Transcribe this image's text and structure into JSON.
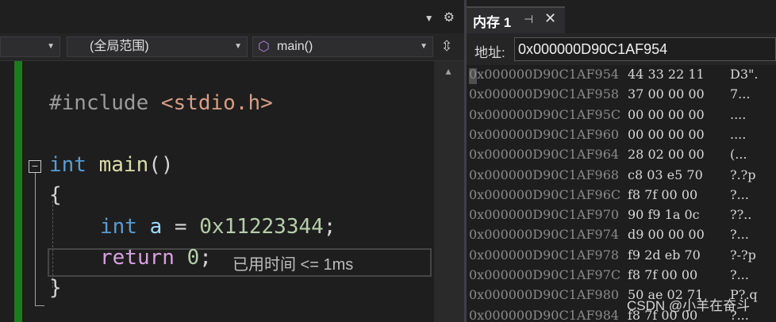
{
  "editor": {
    "navbar": {
      "project_dropdown": "",
      "scope_dropdown": "(全局范围)",
      "function_dropdown": "main()"
    },
    "code_lines": {
      "line1": {
        "text": "#include <stdio.h>",
        "directive": "#include",
        "header": "<stdio.h>"
      },
      "line2": {
        "kw": "int",
        "fn": "main",
        "rest": "()"
      },
      "line3": "{",
      "line4": {
        "kw": "int",
        "var": "a",
        "op": " = ",
        "num": "0x11223344",
        "end": ";"
      },
      "line5": {
        "kw": "return",
        "num": "0",
        "end": ";"
      },
      "line6": "}"
    },
    "perf_tip": "已用时间 <= 1ms",
    "fold_glyph": "⊟"
  },
  "memory": {
    "tab_title": "内存 1",
    "address_label": "地址:",
    "address_value": "0x000000D90C1AF954",
    "rows": [
      {
        "addr": "0x000000D90C1AF954",
        "bytes": "44 33 22 11",
        "ascii": "D3\"."
      },
      {
        "addr": "0x000000D90C1AF958",
        "bytes": "37 00 00 00",
        "ascii": "7..."
      },
      {
        "addr": "0x000000D90C1AF95C",
        "bytes": "00 00 00 00",
        "ascii": "...."
      },
      {
        "addr": "0x000000D90C1AF960",
        "bytes": "00 00 00 00",
        "ascii": "...."
      },
      {
        "addr": "0x000000D90C1AF964",
        "bytes": "28 02 00 00",
        "ascii": "(..."
      },
      {
        "addr": "0x000000D90C1AF968",
        "bytes": "c8 03 e5 70",
        "ascii": "?.?p"
      },
      {
        "addr": "0x000000D90C1AF96C",
        "bytes": "f8 7f 00 00",
        "ascii": "?..."
      },
      {
        "addr": "0x000000D90C1AF970",
        "bytes": "90 f9 1a 0c",
        "ascii": "??.."
      },
      {
        "addr": "0x000000D90C1AF974",
        "bytes": "d9 00 00 00",
        "ascii": "?..."
      },
      {
        "addr": "0x000000D90C1AF978",
        "bytes": "f9 2d eb 70",
        "ascii": "?-?p"
      },
      {
        "addr": "0x000000D90C1AF97C",
        "bytes": "f8 7f 00 00",
        "ascii": "?..."
      },
      {
        "addr": "0x000000D90C1AF980",
        "bytes": "50 ae 02 71",
        "ascii": "P?.q"
      },
      {
        "addr": "0x000000D90C1AF984",
        "bytes": "f8 7f 00 00",
        "ascii": "?..."
      }
    ]
  },
  "watermark": "CSDN @小羊在奋斗",
  "colors": {
    "background": "#1e1e1e",
    "keyword": "#569cd6",
    "function": "#dcdcaa",
    "variable": "#9cdcfe",
    "number": "#b5cea8",
    "control": "#d8a0df",
    "change_bar": "#1f7a1f"
  }
}
